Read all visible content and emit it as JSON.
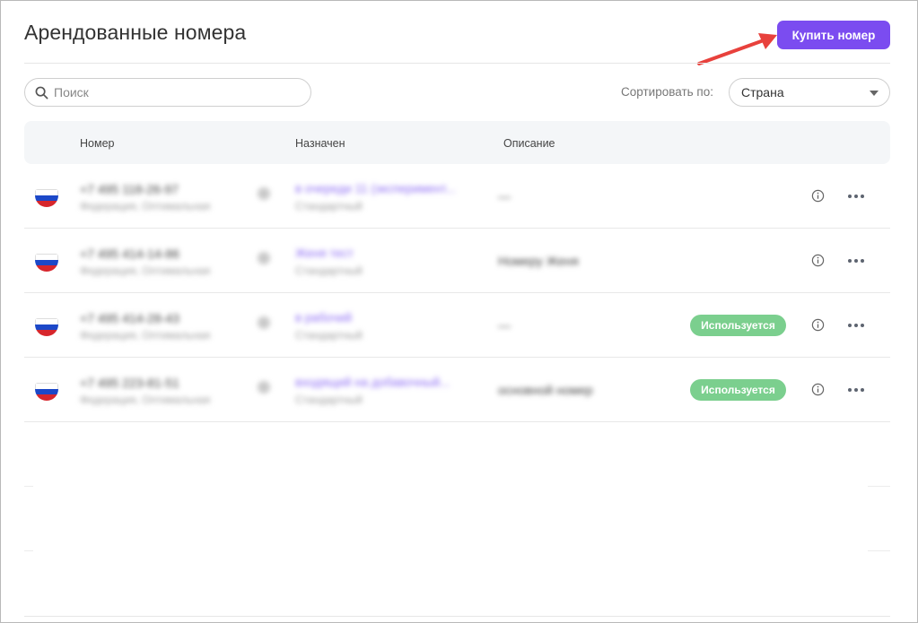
{
  "header": {
    "title": "Арендованные номера",
    "buy_button": "Купить номер"
  },
  "colors": {
    "accent": "#7b4cf0",
    "annotation_arrow": "#e8413c",
    "badge_green": "#7bcf8e"
  },
  "toolbar": {
    "search_placeholder": "Поиск",
    "sort_label": "Сортировать по:",
    "sort_value": "Страна"
  },
  "table": {
    "columns": [
      "Номер",
      "Назначен",
      "Описание"
    ],
    "rows": [
      {
        "country": "Россия",
        "number": "+7 495 118-26-97",
        "number_sub": "Федерация, Оптимальная",
        "assigned": "в очереди 11 (эксперимент...",
        "assigned_sub": "Стандартный",
        "description": "—",
        "status": ""
      },
      {
        "country": "Россия",
        "number": "+7 495 414-14-86",
        "number_sub": "Федерация, Оптимальная",
        "assigned": "Женя тест",
        "assigned_sub": "Стандартный",
        "description": "Номеру Женя",
        "status": ""
      },
      {
        "country": "Россия",
        "number": "+7 495 414-28-43",
        "number_sub": "Федерация, Оптимальная",
        "assigned": "в рабочий",
        "assigned_sub": "Стандартный",
        "description": "—",
        "status": "Используется"
      },
      {
        "country": "Россия",
        "number": "+7 495 223-81-51",
        "number_sub": "Федерация, Оптимальная",
        "assigned": "входящий на добавочный...",
        "assigned_sub": "Стандартный",
        "description": "основной номер",
        "status": "Используется"
      }
    ]
  }
}
